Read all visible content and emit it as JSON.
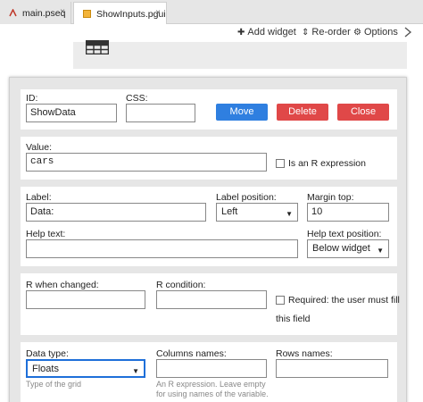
{
  "tabs": [
    {
      "label": "main.pseq",
      "close": "×"
    },
    {
      "label": "ShowInputs.pgui",
      "close": "×"
    }
  ],
  "toolbar": {
    "add_widget": "Add widget",
    "reorder": "Re-order",
    "options": "Options"
  },
  "card_id": {
    "id_label": "ID:",
    "id_value": "ShowData",
    "css_label": "CSS:",
    "css_value": "",
    "move_button": "Move",
    "delete_button": "Delete",
    "close_button": "Close"
  },
  "card_value": {
    "value_label": "Value:",
    "value": "cars",
    "r_expression_label": "Is an R expression",
    "r_expression_checked": false
  },
  "card_label": {
    "label_label": "Label:",
    "label_value": "Data:",
    "label_position_label": "Label position:",
    "label_position_value": "Left",
    "margin_top_label": "Margin top:",
    "margin_top_value": "10",
    "help_text_label": "Help text:",
    "help_text_value": "",
    "help_text_position_label": "Help text position:",
    "help_text_position_value": "Below widget"
  },
  "card_r": {
    "r_when_changed_label": "R when changed:",
    "r_when_changed_value": "",
    "r_condition_label": "R condition:",
    "r_condition_value": "",
    "required_label_line1": "Required: the user must fill",
    "required_label_line2": "this field",
    "required_checked": false
  },
  "card_data": {
    "data_type_label": "Data type:",
    "data_type_value": "Floats",
    "data_type_hint": "Type of the grid",
    "columns_names_label": "Columns names:",
    "columns_names_value": "",
    "columns_hint_line1": "An R expression. Leave empty",
    "columns_hint_line2": "for using names of the variable.",
    "rows_names_label": "Rows names:",
    "rows_names_value": ""
  },
  "colors": {
    "primary": "#2f7fe0",
    "danger": "#e04848"
  }
}
